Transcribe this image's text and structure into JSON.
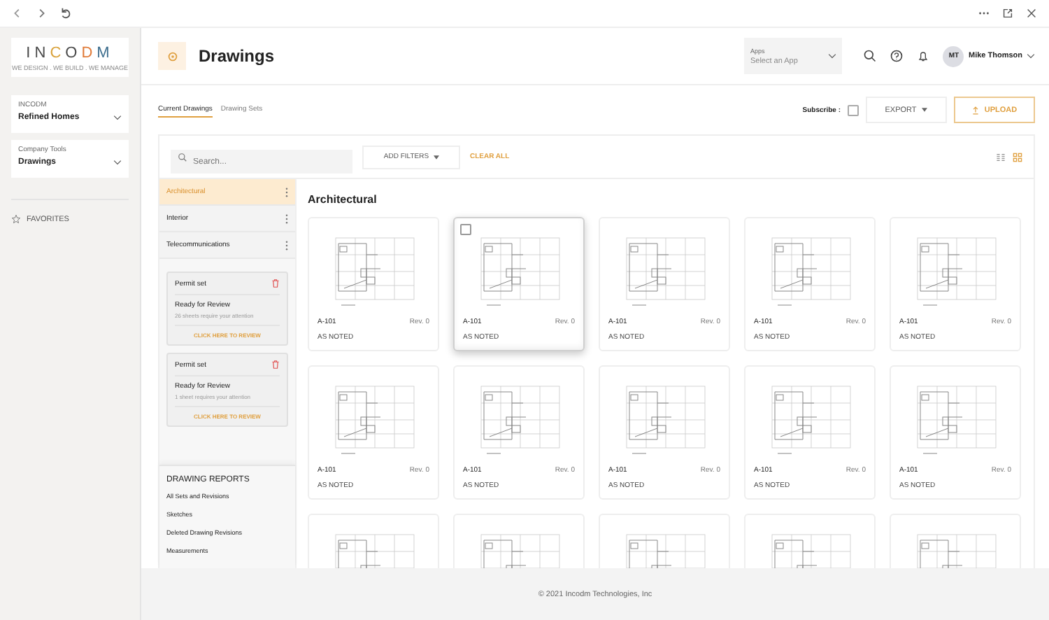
{
  "logo": {
    "letters": [
      {
        "text": "I",
        "color": "#4a4a4a"
      },
      {
        "text": "N",
        "color": "#4a4a4a"
      },
      {
        "text": "C",
        "color": "#d9a23b"
      },
      {
        "text": "O",
        "color": "#4a4a4a"
      },
      {
        "text": "D",
        "color": "#e07b39"
      },
      {
        "text": "M",
        "color": "#3f6f8f"
      }
    ],
    "tagline": "WE DESIGN . WE BUILD . WE MANAGE"
  },
  "sidebar": {
    "selectors": [
      {
        "label": "INCODM",
        "value": "Refined Homes"
      },
      {
        "label": "Company Tools",
        "value": "Drawings"
      }
    ],
    "favorites": "FAVORITES"
  },
  "header": {
    "title": "Drawings",
    "apps": {
      "label": "Apps",
      "placeholder": "Select an App"
    },
    "user": {
      "initials": "MT",
      "name": "Mike Thomson"
    }
  },
  "tabs": [
    {
      "label": "Current Drawings",
      "selected": true
    },
    {
      "label": "Drawing Sets",
      "selected": false
    }
  ],
  "actions": {
    "subscribe": {
      "label": "Subscribe :",
      "checked": false
    },
    "export": "EXPORT",
    "upload": "UPLOAD"
  },
  "toolbar": {
    "search_placeholder": "Search...",
    "add_filters": "ADD FILTERS",
    "clear_all": "CLEAR ALL",
    "views": [
      {
        "kind": "list",
        "selected": false
      },
      {
        "kind": "grid",
        "selected": true
      }
    ]
  },
  "categories": [
    {
      "label": "Architectural",
      "selected": true
    },
    {
      "label": "Interior",
      "selected": false
    },
    {
      "label": "Telecommunications",
      "selected": false
    }
  ],
  "permit_sets": [
    {
      "title": "Permit set",
      "status": "Ready for Review",
      "message": "26 sheets require your attention",
      "link": "CLICK HERE TO REVIEW"
    },
    {
      "title": "Permit set",
      "status": "Ready for Review",
      "message": "1 sheet requires your attention",
      "link": "CLICK HERE TO REVIEW"
    }
  ],
  "reports": {
    "title": "DRAWING REPORTS",
    "items": [
      "All Sets and Revisions",
      "Sketches",
      "Deleted Drawing Revisions",
      "Measurements"
    ]
  },
  "grid": {
    "title": "Architectural",
    "cards": [
      {
        "kind": "full",
        "sheet": "A-101",
        "rev": "Rev. 0",
        "scale": "AS NOTED",
        "hovered": false
      },
      {
        "kind": "full",
        "sheet": "A-101",
        "rev": "Rev. 0",
        "scale": "AS NOTED",
        "hovered": true
      },
      {
        "kind": "full",
        "sheet": "A-101",
        "rev": "Rev. 0",
        "scale": "AS NOTED",
        "hovered": false
      },
      {
        "kind": "full",
        "sheet": "A-101",
        "rev": "Rev. 0",
        "scale": "AS NOTED",
        "hovered": false
      },
      {
        "kind": "full",
        "sheet": "A-101",
        "rev": "Rev. 0",
        "scale": "AS NOTED",
        "hovered": false
      },
      {
        "kind": "full",
        "sheet": "A-101",
        "rev": "Rev. 0",
        "scale": "AS NOTED",
        "hovered": false
      },
      {
        "kind": "full",
        "sheet": "A-101",
        "rev": "Rev. 0",
        "scale": "AS NOTED",
        "hovered": false
      },
      {
        "kind": "full",
        "sheet": "A-101",
        "rev": "Rev. 0",
        "scale": "AS NOTED",
        "hovered": false
      },
      {
        "kind": "full",
        "sheet": "A-101",
        "rev": "Rev. 0",
        "scale": "AS NOTED",
        "hovered": false
      },
      {
        "kind": "full",
        "sheet": "A-101",
        "rev": "Rev. 0",
        "scale": "AS NOTED",
        "hovered": false
      },
      {
        "kind": "partial",
        "hovered": false
      },
      {
        "kind": "partial",
        "hovered": false
      },
      {
        "kind": "partial",
        "hovered": false
      },
      {
        "kind": "partial",
        "hovered": false
      },
      {
        "kind": "partial",
        "hovered": false
      }
    ]
  },
  "footer": "© 2021 Incodm Technologies, Inc"
}
